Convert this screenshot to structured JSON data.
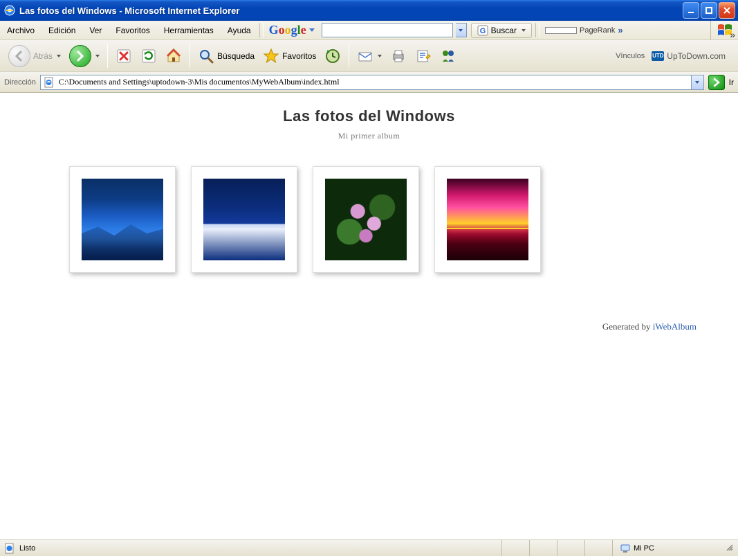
{
  "window": {
    "title": "Las fotos del Windows - Microsoft Internet Explorer"
  },
  "menu": {
    "items": [
      "Archivo",
      "Edición",
      "Ver",
      "Favoritos",
      "Herramientas",
      "Ayuda"
    ]
  },
  "google_toolbar": {
    "search_value": "",
    "buscar_label": "Buscar",
    "pagerank_label": "PageRank",
    "expand_glyph": "»"
  },
  "toolbar": {
    "back_label": "Atrás",
    "search_label": "Búsqueda",
    "favorites_label": "Favoritos",
    "links_label": "Vínculos",
    "links_site": "UpToDown.com",
    "links_badge": "UTD"
  },
  "address": {
    "label": "Dirección",
    "value": "C:\\Documents and Settings\\uptodown-3\\Mis documentos\\MyWebAlbum\\index.html",
    "go_label": "Ir"
  },
  "page": {
    "title": "Las fotos del Windows",
    "subtitle": "Mi primer album",
    "thumbs": [
      {
        "name": "blue-hills"
      },
      {
        "name": "winter"
      },
      {
        "name": "water-lilies"
      },
      {
        "name": "sunset"
      }
    ],
    "generated_prefix": "Generated by ",
    "generated_link": "iWebAlbum"
  },
  "status": {
    "ready": "Listo",
    "zone": "Mi PC"
  }
}
